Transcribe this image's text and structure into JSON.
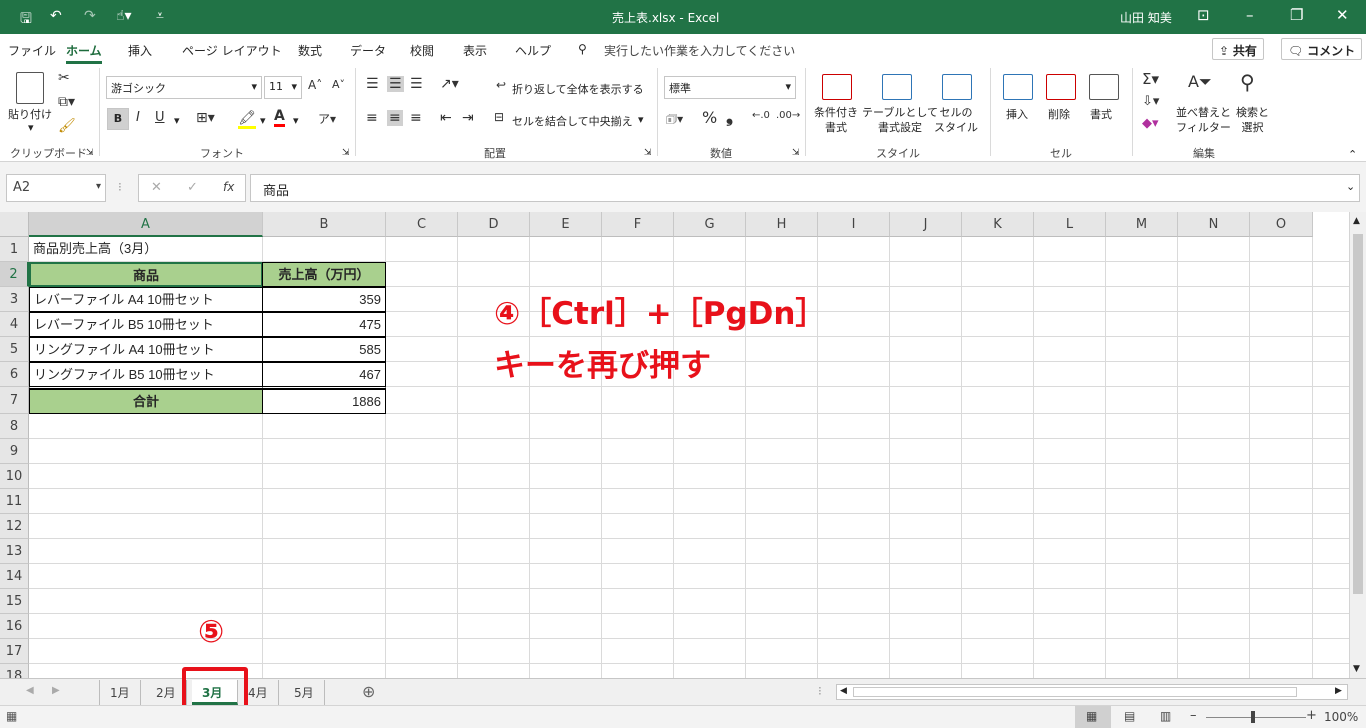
{
  "titlebar": {
    "file_title": "売上表.xlsx  -  Excel",
    "user": "山田 知美"
  },
  "menu": {
    "tabs": [
      "ファイル",
      "ホーム",
      "挿入",
      "ページ レイアウト",
      "数式",
      "データ",
      "校閲",
      "表示",
      "ヘルプ"
    ],
    "active_tab": "ホーム",
    "search_placeholder": "実行したい作業を入力してください",
    "share_label": "共有",
    "comment_label": "コメント"
  },
  "ribbon": {
    "clipboard": {
      "paste": "貼り付け",
      "label": "クリップボード"
    },
    "font": {
      "name": "游ゴシック",
      "size": "11",
      "bold": "B",
      "italic": "I",
      "underline": "U",
      "label": "フォント"
    },
    "alignment": {
      "wrap": "折り返して全体を表示する",
      "merge": "セルを結合して中央揃え",
      "label": "配置"
    },
    "number": {
      "format": "標準",
      "label": "数値"
    },
    "styles": {
      "cond": "条件付き\n書式",
      "table": "テーブルとして\n書式設定",
      "cell": "セルの\nスタイル",
      "label": "スタイル"
    },
    "cells": {
      "insert": "挿入",
      "delete": "削除",
      "format": "書式",
      "label": "セル"
    },
    "editing": {
      "sort": "並べ替えと\nフィルター",
      "find": "検索と\n選択",
      "label": "編集"
    }
  },
  "formula_bar": {
    "name_box": "A2",
    "formula": "商品"
  },
  "columns": [
    "A",
    "B",
    "C",
    "D",
    "E",
    "F",
    "G",
    "H",
    "I",
    "J",
    "K",
    "L",
    "M",
    "N",
    "O"
  ],
  "selected_column": "A",
  "rows": [
    "1",
    "2",
    "3",
    "4",
    "5",
    "6",
    "7",
    "8",
    "9",
    "10",
    "11",
    "12",
    "13",
    "14",
    "15",
    "16",
    "17",
    "18"
  ],
  "selected_row": "2",
  "sheet": {
    "title_cell": "商品別売上高（3月）",
    "header_product": "商品",
    "header_sales": "売上高（万円）",
    "items": [
      {
        "product": "レバーファイル A4 10冊セット",
        "sales": "359"
      },
      {
        "product": "レバーファイル B5 10冊セット",
        "sales": "475"
      },
      {
        "product": "リングファイル A4 10冊セット",
        "sales": "585"
      },
      {
        "product": "リングファイル B5 10冊セット",
        "sales": "467"
      }
    ],
    "total_label": "合計",
    "total_value": "1886"
  },
  "annotations": {
    "step4_line1": "④［Ctrl］+［PgDn］",
    "step4_line2": "キーを再び押す",
    "step5": "⑤",
    "accent_color": "#e8111a"
  },
  "sheet_tabs": [
    "1月",
    "2月",
    "3月",
    "4月",
    "5月"
  ],
  "active_sheet": "3月",
  "statusbar": {
    "zoom": "100%"
  },
  "colors": {
    "brand": "#217346",
    "header_fill": "#a9d08e"
  }
}
